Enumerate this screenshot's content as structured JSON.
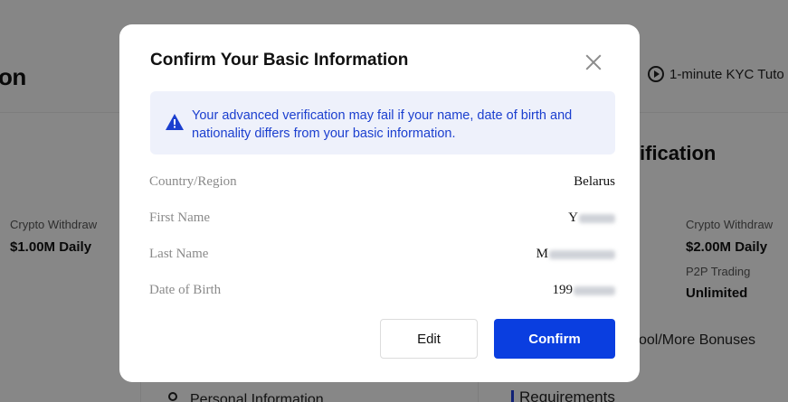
{
  "background": {
    "page_title_fragment": "on",
    "tutorial_link": "1-minute KYC Tuto",
    "left_card": {
      "limit_label": "Crypto Withdraw",
      "limit_value": "$1.00M Daily",
      "bottom_item": "Personal Information"
    },
    "right_card": {
      "heading_fragment": "ification",
      "limit_label": "Crypto Withdraw",
      "limit_value": "$2.00M Daily",
      "p2p_label": "P2P Trading",
      "p2p_value": "Unlimited",
      "perks_fragment": "ool/More Bonuses",
      "requirements_label": "Requirements"
    }
  },
  "modal": {
    "title": "Confirm Your Basic Information",
    "notice": "Your advanced verification may fail if your name, date of birth and nationality differs from your basic information.",
    "fields": [
      {
        "label": "Country/Region",
        "value": "Belarus"
      },
      {
        "label": "First Name",
        "value": "Y"
      },
      {
        "label": "Last Name",
        "value": "M"
      },
      {
        "label": "Date of Birth",
        "value": "199"
      }
    ],
    "edit_label": "Edit",
    "confirm_label": "Confirm"
  },
  "colors": {
    "accent": "#0a3ee0",
    "notice_bg": "#eef1fb",
    "notice_text": "#1b3fcf"
  },
  "icons": {
    "close": "close-icon",
    "warning": "warning-icon",
    "play": "play-circle-icon",
    "person": "person-icon"
  }
}
